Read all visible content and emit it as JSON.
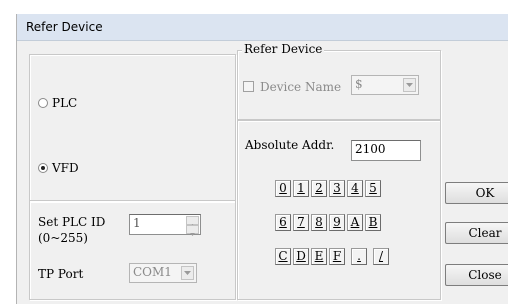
{
  "window": {
    "title": "Refer Device"
  },
  "mode": {
    "options": [
      {
        "label": "PLC",
        "checked": false
      },
      {
        "label": "VFD",
        "checked": true
      }
    ]
  },
  "plc_id": {
    "label_line1": "Set PLC ID",
    "label_line2": "(0~255)",
    "value": "1"
  },
  "tp_port": {
    "label": "TP Port",
    "value": "COM1"
  },
  "refer_device": {
    "group_label": "Refer Device",
    "checkbox_label": "Device Name",
    "checked": false,
    "combo_value": "$"
  },
  "absolute_addr": {
    "label": "Absolute Addr.",
    "value": "2100"
  },
  "keypad": {
    "rows": [
      [
        "0",
        "1",
        "2",
        "3",
        "4",
        "5"
      ],
      [
        "6",
        "7",
        "8",
        "9",
        "A",
        "B"
      ],
      [
        "C",
        "D",
        "E",
        "F",
        ".",
        "/"
      ]
    ]
  },
  "buttons": {
    "ok": "OK",
    "clear": "Clear",
    "close": "Close"
  }
}
